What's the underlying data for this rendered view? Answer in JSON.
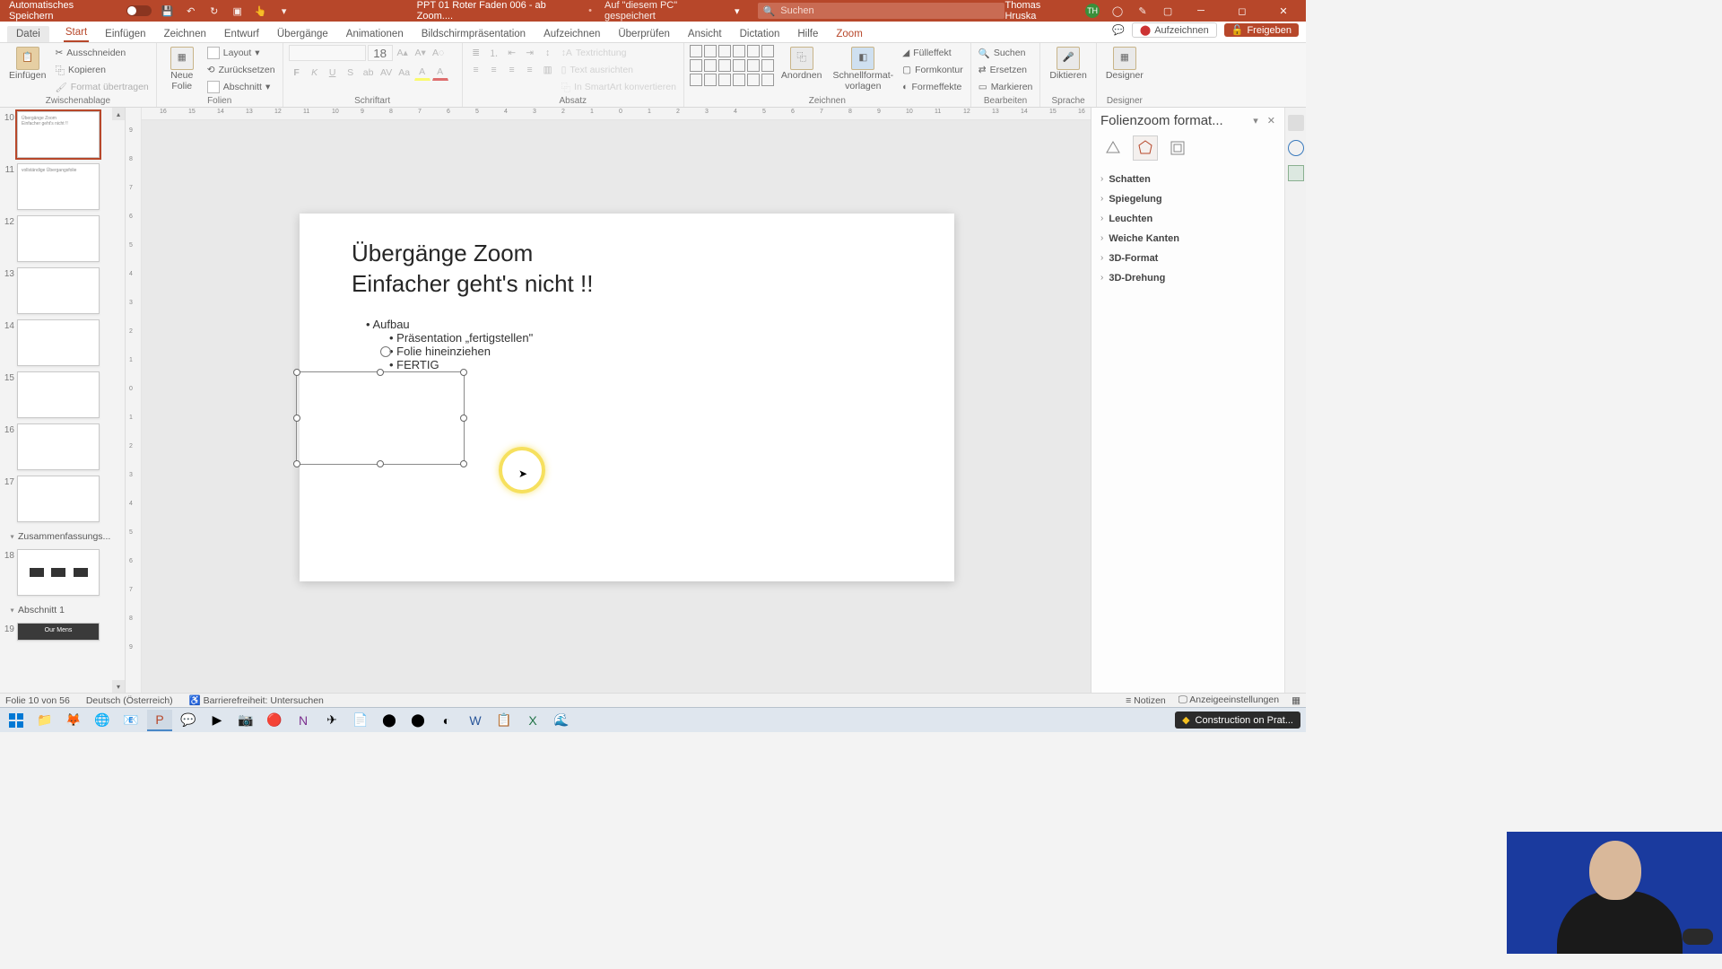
{
  "titlebar": {
    "autosave_label": "Automatisches Speichern",
    "doc_name": "PPT 01 Roter Faden 006 - ab Zoom....",
    "save_location": "Auf \"diesem PC\" gespeichert",
    "search_placeholder": "Suchen",
    "user_name": "Thomas Hruska",
    "user_initials": "TH"
  },
  "tabs": {
    "file": "Datei",
    "items": [
      "Start",
      "Einfügen",
      "Zeichnen",
      "Entwurf",
      "Übergänge",
      "Animationen",
      "Bildschirmpräsentation",
      "Aufzeichnen",
      "Überprüfen",
      "Ansicht",
      "Dictation",
      "Hilfe",
      "Zoom"
    ],
    "active_index": 0,
    "record_btn": "Aufzeichnen",
    "share_btn": "Freigeben"
  },
  "ribbon": {
    "clipboard": {
      "label": "Zwischenablage",
      "paste": "Einfügen",
      "cut": "Ausschneiden",
      "copy": "Kopieren",
      "format_painter": "Format übertragen"
    },
    "slides": {
      "label": "Folien",
      "new_slide": "Neue\nFolie",
      "layout": "Layout",
      "reset": "Zurücksetzen",
      "section": "Abschnitt"
    },
    "font": {
      "label": "Schriftart",
      "size": "18",
      "bold": "F",
      "italic": "K",
      "underline": "U",
      "strike": "S"
    },
    "paragraph": {
      "label": "Absatz",
      "text_direction": "Textrichtung",
      "align_text": "Text ausrichten",
      "smartart": "In SmartArt konvertieren"
    },
    "drawing": {
      "label": "Zeichnen",
      "arrange": "Anordnen",
      "quick_styles": "Schnellformat-\nvorlagen",
      "fill": "Fülleffekt",
      "outline": "Formkontur",
      "effects": "Formeffekte"
    },
    "editing": {
      "label": "Bearbeiten",
      "find": "Suchen",
      "replace": "Ersetzen",
      "select": "Markieren"
    },
    "voice": {
      "label": "Sprache",
      "dictate": "Diktieren"
    },
    "designer": {
      "label": "Designer",
      "btn": "Designer"
    }
  },
  "ruler_h": [
    "16",
    "15",
    "14",
    "13",
    "12",
    "11",
    "10",
    "9",
    "8",
    "7",
    "6",
    "5",
    "4",
    "3",
    "2",
    "1",
    "0",
    "1",
    "2",
    "3",
    "4",
    "5",
    "6",
    "7",
    "8",
    "9",
    "10",
    "11",
    "12",
    "13",
    "14",
    "15",
    "16"
  ],
  "ruler_v": [
    "9",
    "8",
    "7",
    "6",
    "5",
    "4",
    "3",
    "2",
    "1",
    "0",
    "1",
    "2",
    "3",
    "4",
    "5",
    "6",
    "7",
    "8",
    "9"
  ],
  "thumbs": {
    "numbers": [
      "10",
      "11",
      "12",
      "13",
      "14",
      "15",
      "16",
      "17",
      "18",
      "19"
    ],
    "section1": "Zusammenfassungs...",
    "section2": "Abschnitt 1",
    "slide18_overlay": "Our Mens"
  },
  "slide": {
    "title_line1": "Übergänge Zoom",
    "title_line2": "Einfacher geht's nicht !!",
    "bullet1": "Aufbau",
    "bullet2": "Präsentation „fertigstellen\"",
    "bullet3": "Folie hineinziehen",
    "bullet4": "FERTIG"
  },
  "rightpane": {
    "title": "Folienzoom format...",
    "items": [
      "Schatten",
      "Spiegelung",
      "Leuchten",
      "Weiche Kanten",
      "3D-Format",
      "3D-Drehung"
    ]
  },
  "statusbar": {
    "slide_pos": "Folie 10 von 56",
    "language": "Deutsch (Österreich)",
    "accessibility": "Barrierefreiheit: Untersuchen",
    "notes": "Notizen",
    "display": "Anzeigeeinstellungen"
  },
  "taskbar": {
    "notification": "Construction on Prat..."
  }
}
